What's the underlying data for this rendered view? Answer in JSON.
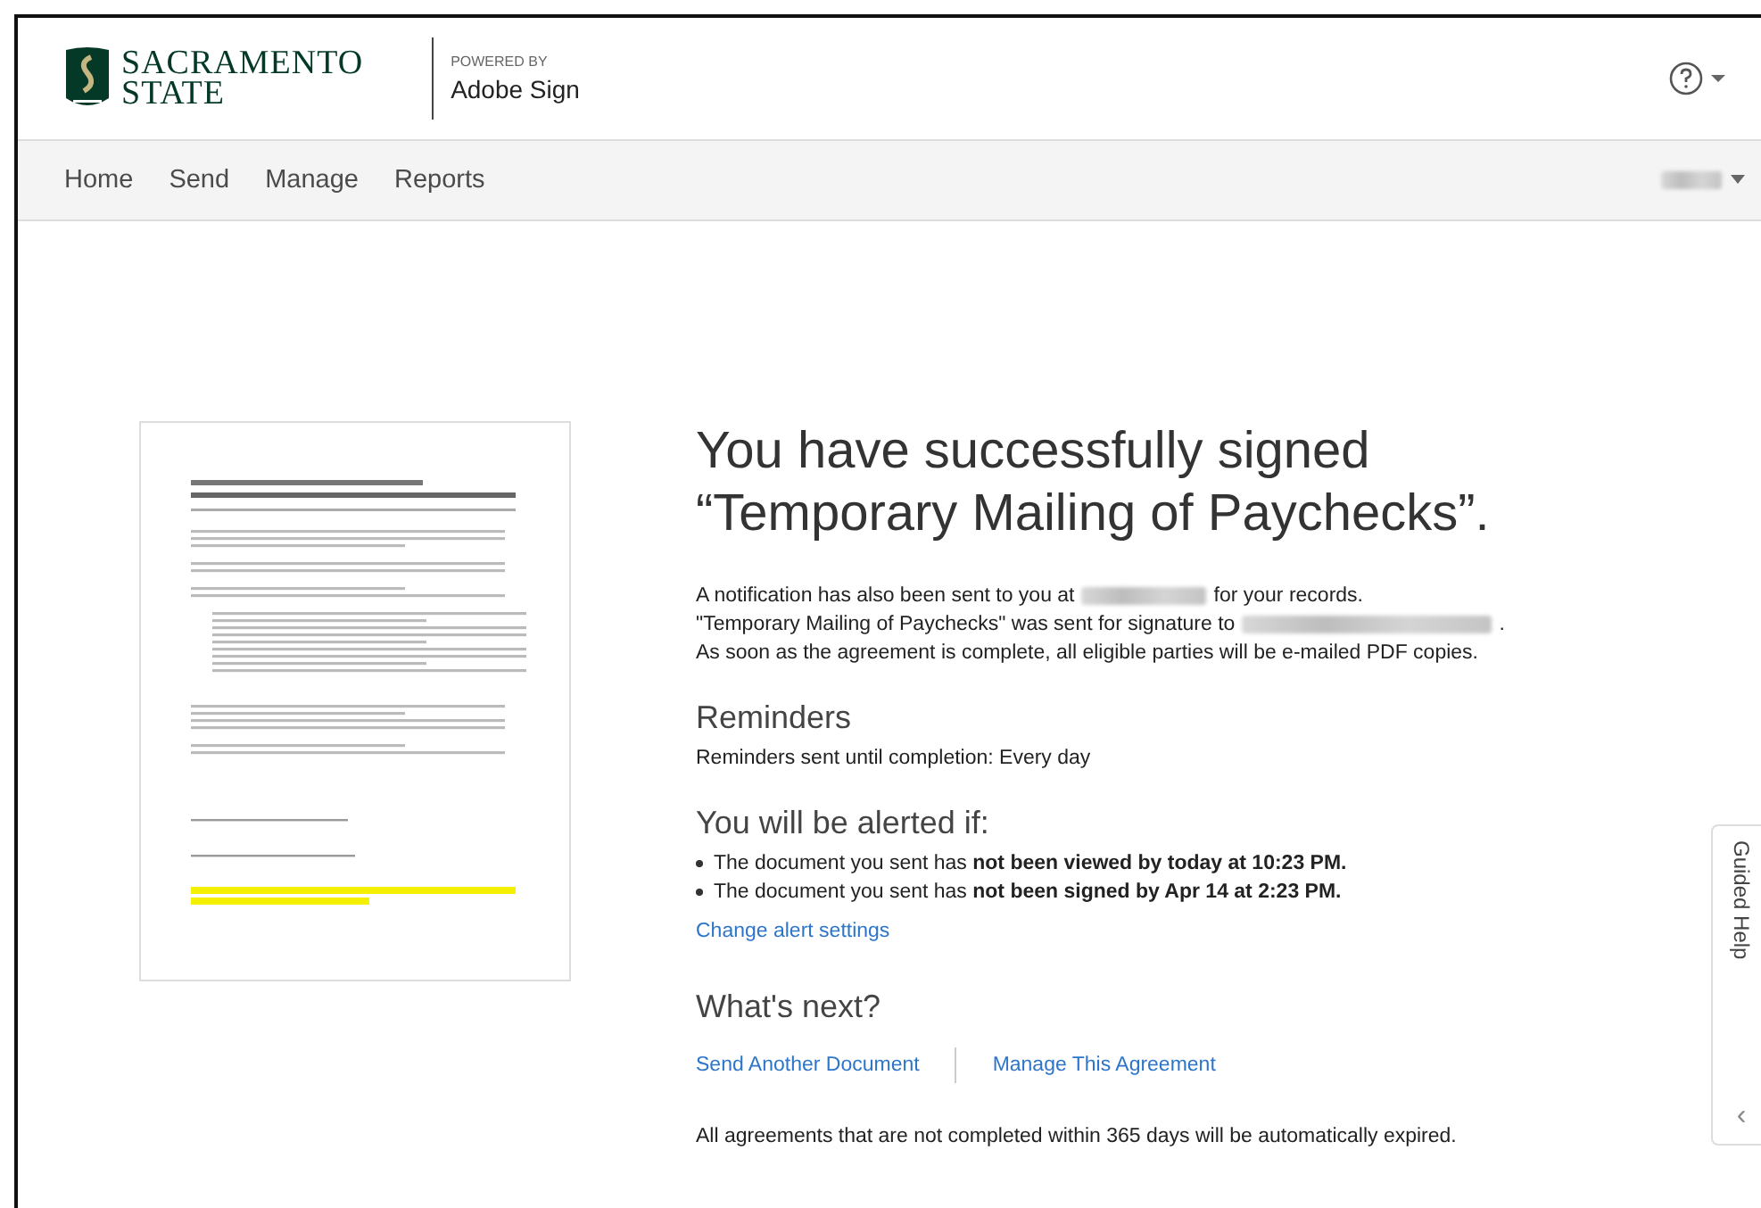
{
  "header": {
    "logo_line_1": "SACRAMENTO",
    "logo_line_2": "STATE",
    "powered_by": "POWERED BY",
    "product": "Adobe Sign"
  },
  "nav": {
    "items": [
      {
        "label": "Home",
        "selected": false
      },
      {
        "label": "Send",
        "selected": false
      },
      {
        "label": "Manage",
        "selected": false
      },
      {
        "label": "Reports",
        "selected": false
      }
    ]
  },
  "confirmation": {
    "title_line_1": "You have successfully signed",
    "title_line_2": "“Temporary Mailing of Paychecks”.",
    "notice_1_before": "A notification has also been sent to you at",
    "notice_1_after": "for your records.",
    "notice_2_before": "\"Temporary Mailing of Paychecks\" was sent for signature to",
    "notice_2_after": ".",
    "notice_3": "As soon as the agreement is complete, all eligible parties will be e-mailed PDF copies."
  },
  "reminders": {
    "heading": "Reminders",
    "text": "Reminders sent until completion: Every day"
  },
  "alerts": {
    "heading": "You will be alerted if:",
    "items": [
      "The document you sent has **not been viewed by today at 10:23 PM.**",
      "The document you sent has **not been signed by Apr 14 at 2:23 PM.**"
    ],
    "link": "Change alert settings"
  },
  "next": {
    "heading": "What's next?",
    "links": [
      "Send Another Document",
      "Manage This Agreement"
    ],
    "footnote": "All agreements that are not completed within 365 days will be automatically expired."
  },
  "guided_help": {
    "label": "Guided Help",
    "arrow": "‹"
  }
}
